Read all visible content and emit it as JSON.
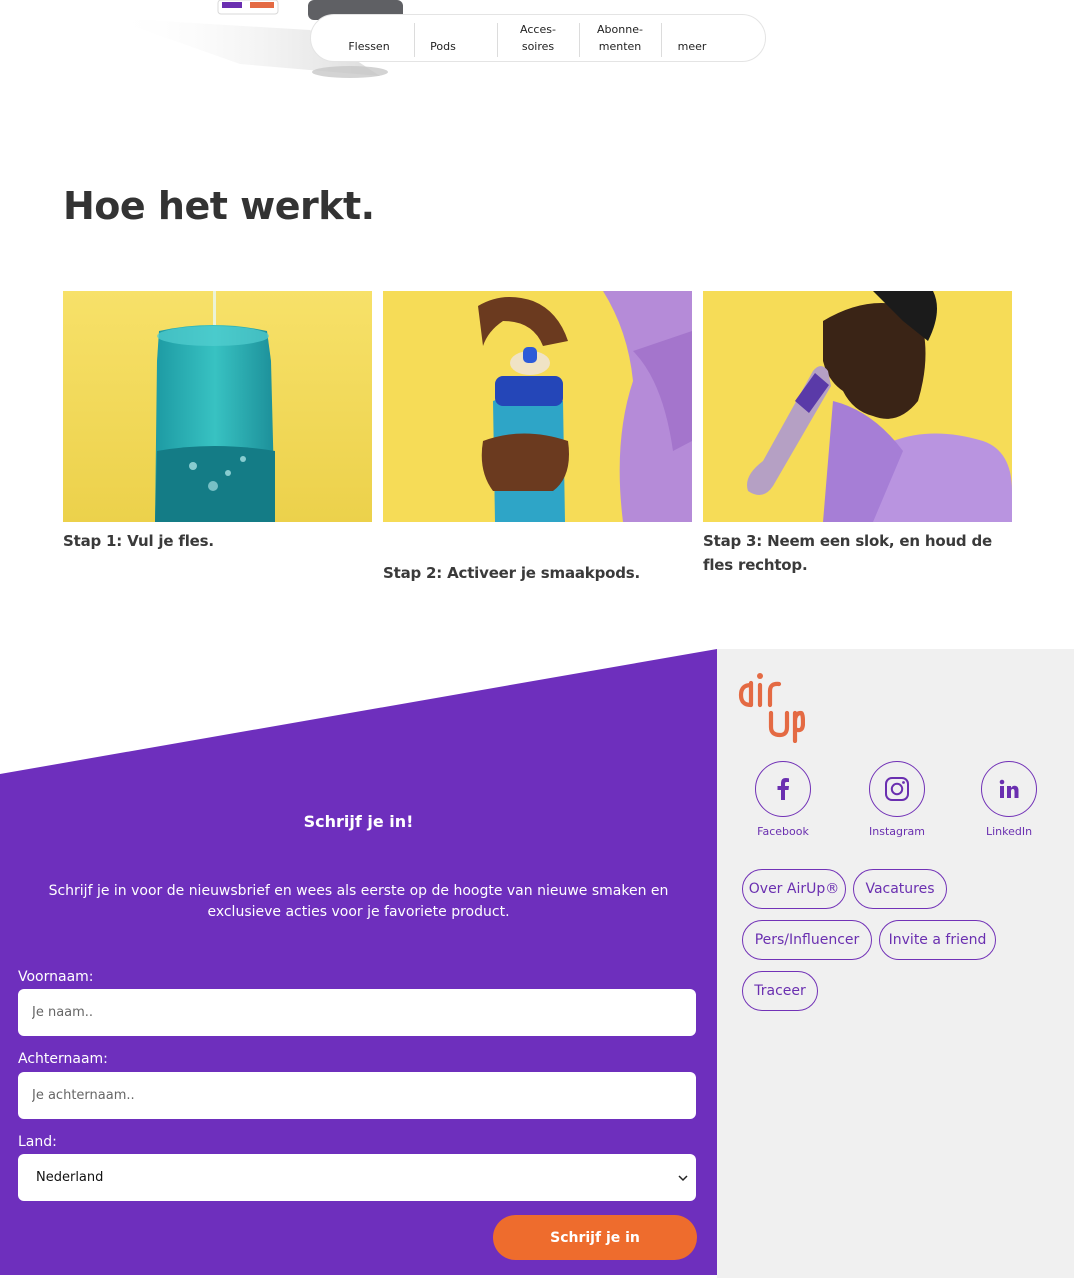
{
  "nav": {
    "items": [
      {
        "label": "Flessen"
      },
      {
        "label": "Pods"
      },
      {
        "label": "Acces-\nsoires"
      },
      {
        "label": "Abonne-\nmenten"
      },
      {
        "label": "meer"
      }
    ]
  },
  "how": {
    "title": "Hoe het werkt.",
    "steps": [
      {
        "caption": "Stap 1: Vul je fles."
      },
      {
        "caption": "Stap 2: Activeer je smaakpods."
      },
      {
        "caption": "Stap 3: Neem een slok, en houd de fles rechtop."
      }
    ]
  },
  "newsletter": {
    "title": "Schrijf je in!",
    "description": "Schrijf je in voor de nieuwsbrief en wees als eerste op de hoogte van nieuwe smaken en exclusieve acties voor je favoriete product.",
    "first_name_label": "Voornaam:",
    "first_name_placeholder": "Je naam..",
    "first_name_value": "",
    "last_name_label": "Achternaam:",
    "last_name_placeholder": "Je achternaam..",
    "last_name_value": "",
    "country_label": "Land:",
    "country_value": "Nederland",
    "submit_label": "Schrijf je in"
  },
  "footer": {
    "logo_text": "air up",
    "social": [
      {
        "label": "Facebook",
        "icon": "facebook-icon"
      },
      {
        "label": "Instagram",
        "icon": "instagram-icon"
      },
      {
        "label": "LinkedIn",
        "icon": "linkedin-icon"
      }
    ],
    "links": [
      {
        "label": "Over AirUp®"
      },
      {
        "label": "Vacatures"
      },
      {
        "label": "Pers/Influencer"
      },
      {
        "label": "Invite a friend"
      },
      {
        "label": "Traceer"
      }
    ]
  },
  "colors": {
    "purple": "#6e2fbd",
    "orange": "#ee6c2d",
    "logo": "#e46a43",
    "yellow": "#f6dc57"
  }
}
